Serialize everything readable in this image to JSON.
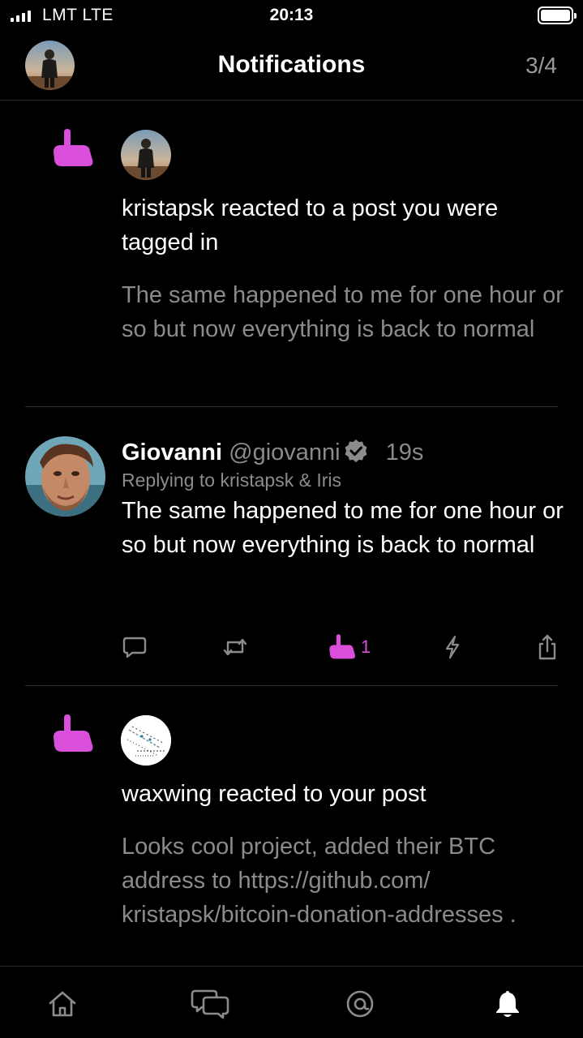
{
  "status_bar": {
    "carrier": "LMT  LTE",
    "time": "20:13"
  },
  "header": {
    "title": "Notifications",
    "count": "3/4"
  },
  "notifications": [
    {
      "text": "kristapsk reacted to a post you were tagged in",
      "quote": "The same happened to me for one hour or so but now everything is back to normal"
    },
    {
      "text": "waxwing reacted to your post",
      "quote": "Looks cool project, added their BTC address to https://github.com/ kristapsk/bitcoin-donation-addresses ."
    }
  ],
  "post": {
    "name": "Giovanni",
    "handle": "@giovanni",
    "time": "19s",
    "reply_to": "Replying to kristapsk & Iris",
    "body": "The same happened to me for one hour or so but now everything is back to normal",
    "reaction_count": "1"
  },
  "colors": {
    "accent": "#d94fdb",
    "muted_text": "#8b8b8b",
    "background": "#000000"
  },
  "icons": {
    "reaction": "shaka-hand-icon",
    "tabs": [
      "home-icon",
      "messages-icon",
      "search-icon",
      "notifications-bell-icon"
    ]
  }
}
